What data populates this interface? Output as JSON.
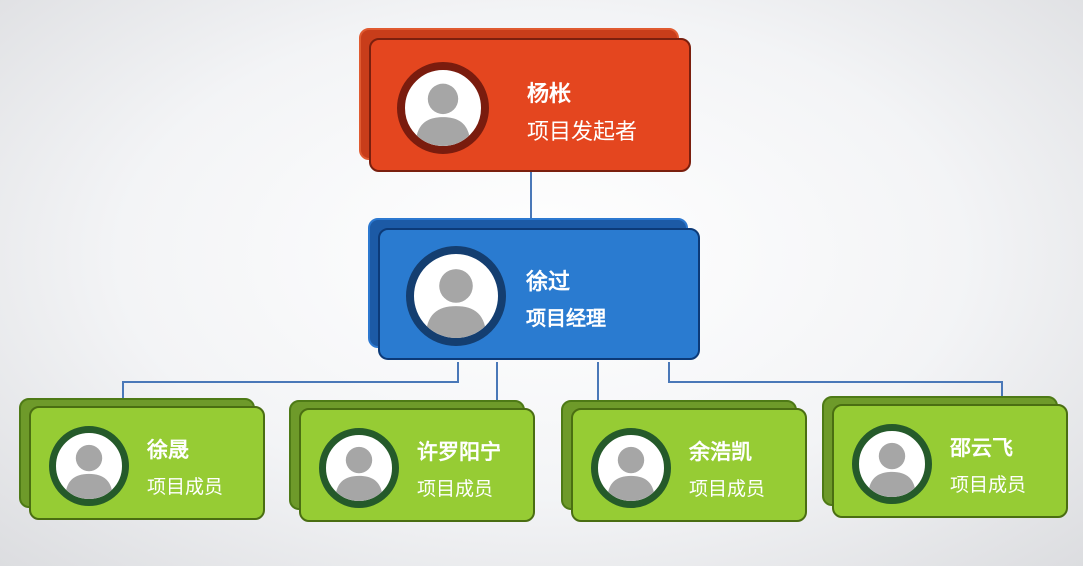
{
  "org_chart": {
    "initiator": {
      "name": "杨枨",
      "role": "项目发起者"
    },
    "manager": {
      "name": "徐过",
      "role": "项目经理"
    },
    "members": [
      {
        "name": "徐晟",
        "role": "项目成员"
      },
      {
        "name": "许罗阳宁",
        "role": "项目成员"
      },
      {
        "name": "余浩凯",
        "role": "项目成员"
      },
      {
        "name": "邵云飞",
        "role": "项目成员"
      }
    ]
  },
  "colors": {
    "initiator": "#e4461f",
    "manager": "#2a7bd0",
    "member": "#96cc34",
    "connector": "#4a78b8"
  },
  "icons": {
    "avatar": "person-silhouette-icon"
  }
}
